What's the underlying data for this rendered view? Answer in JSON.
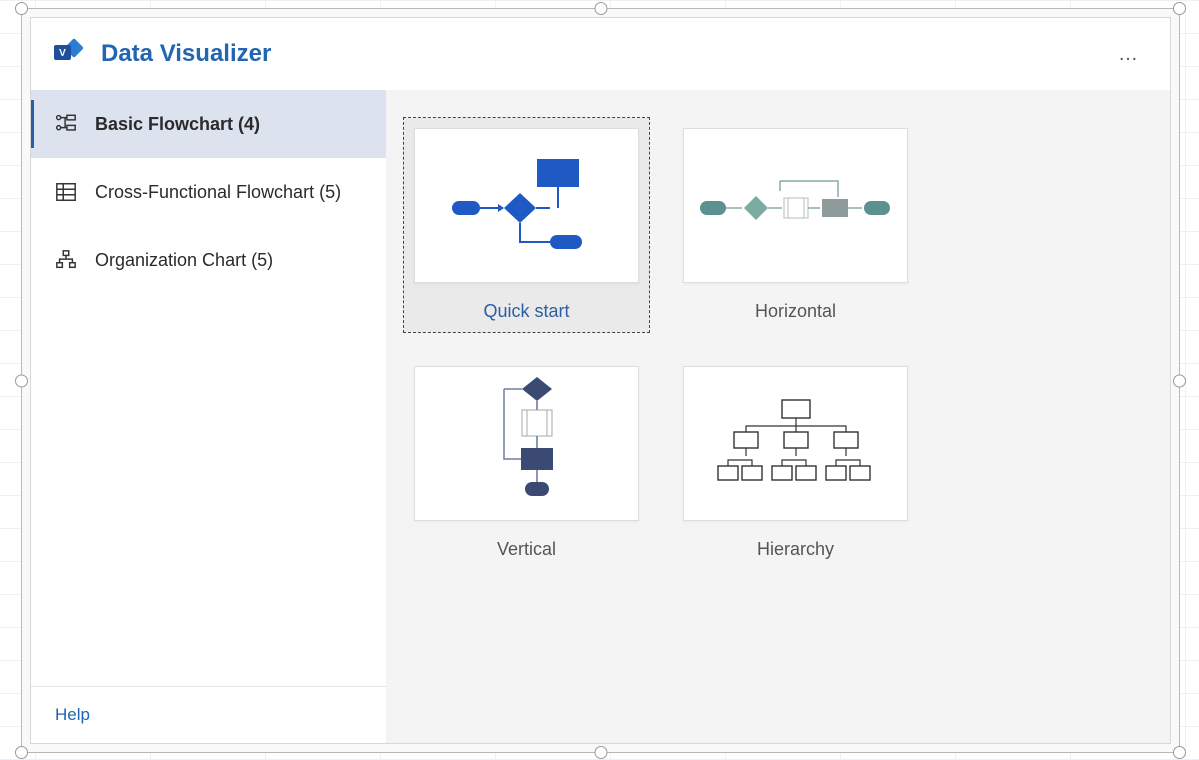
{
  "header": {
    "title": "Data Visualizer",
    "more_label": "…"
  },
  "sidebar": {
    "items": [
      {
        "icon": "flowchart-icon",
        "label": "Basic Flowchart (4)",
        "active": true
      },
      {
        "icon": "crossfunc-icon",
        "label": "Cross-Functional Flowchart (5)",
        "active": false
      },
      {
        "icon": "orgchart-icon",
        "label": "Organization Chart (5)",
        "active": false
      }
    ],
    "help": "Help"
  },
  "templates": [
    {
      "label": "Quick start",
      "selected": true,
      "preview": "flow"
    },
    {
      "label": "Horizontal",
      "selected": false,
      "preview": "horiz"
    },
    {
      "label": "Vertical",
      "selected": false,
      "preview": "vert"
    },
    {
      "label": "Hierarchy",
      "selected": false,
      "preview": "hier"
    }
  ],
  "colors": {
    "accent": "#2165b3",
    "blue": "#1f59c3",
    "teal": "#5b9191",
    "navy": "#3a4a73"
  }
}
